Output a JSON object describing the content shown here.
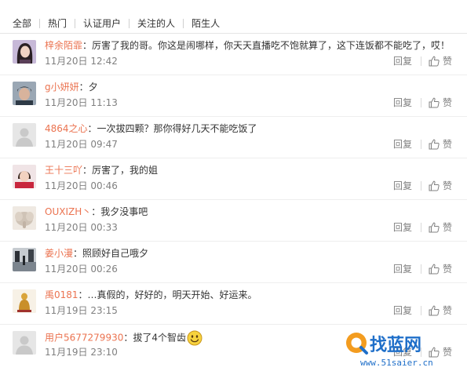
{
  "tabs": [
    "全部",
    "热门",
    "认证用户",
    "关注的人",
    "陌生人"
  ],
  "actions": {
    "reply_label": "回复",
    "like_label": "赞"
  },
  "colors": {
    "username": "#eb7350",
    "meta": "#808080",
    "text": "#333333"
  },
  "comments": [
    {
      "user": "梓余陌霏",
      "text": "：厉害了我的哥。你这是闹哪样，你天天直播吃不饱就算了，这下连饭都不能吃了，哎！",
      "time": "11月20日 12:42",
      "avatar": "photo-girl-dark-hair"
    },
    {
      "user": "g小妍妍",
      "text": "：夕",
      "time": "11月20日 11:13",
      "avatar": "photo-boy"
    },
    {
      "user": "4864之心",
      "text": "：一次拔四颗？那你得好几天不能吃饭了",
      "time": "11月20日 09:47",
      "avatar": "default-avatar"
    },
    {
      "user": "王十三吖",
      "text": "：厉害了，我的姐",
      "time": "11月20日 00:46",
      "avatar": "photo-girl-red"
    },
    {
      "user": "OUXIZH丶",
      "text": "：我夕没事吧",
      "time": "11月20日 00:33",
      "avatar": "photo-elephant"
    },
    {
      "user": "姜小漫",
      "text": "：照顾好自己哦夕",
      "time": "11月20日 00:26",
      "avatar": "photo-street"
    },
    {
      "user": "禹0181",
      "text": "：…真假的，好好的，明天开始、好运来。",
      "time": "11月19日 23:15",
      "avatar": "photo-statue"
    },
    {
      "user": "用户5677279930",
      "text": "：拔了4个智齿",
      "time": "11月19日 23:10",
      "avatar": "default-avatar",
      "emoji": "smile-emoji"
    }
  ],
  "watermark": {
    "logo": "找蓝网",
    "url": "www.51saier.cn"
  }
}
